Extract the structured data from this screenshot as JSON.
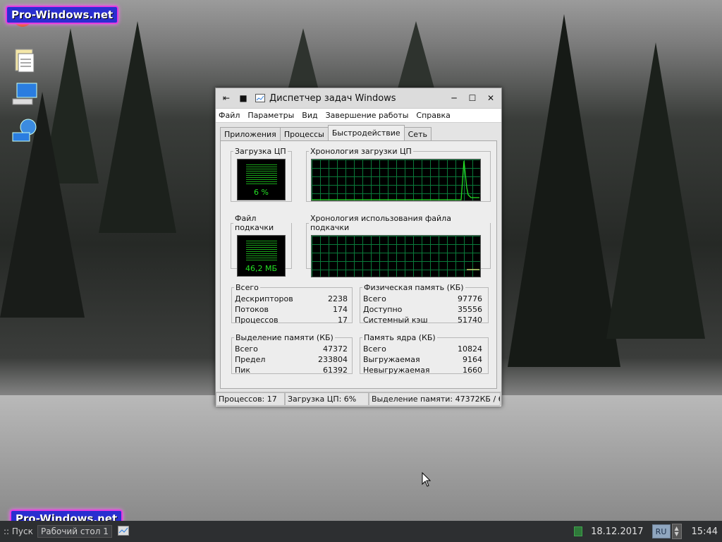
{
  "watermark": "Pro-Windows.net",
  "window": {
    "title": "Диспетчер задач Windows",
    "menu": [
      "Файл",
      "Параметры",
      "Вид",
      "Завершение работы",
      "Справка"
    ],
    "tabs": [
      "Приложения",
      "Процессы",
      "Быстродействие",
      "Сеть"
    ],
    "active_tab": "Быстродействие"
  },
  "cpu": {
    "label": "Загрузка ЦП",
    "value": "6 %",
    "history_label": "Хронология загрузки ЦП"
  },
  "page_file": {
    "label": "Файл подкачки",
    "value": "46,2 МБ",
    "history_label": "Хронология использования файла подкачки"
  },
  "totals": {
    "label": "Всего",
    "rows": [
      {
        "name": "Дескрипторов",
        "value": "2238"
      },
      {
        "name": "Потоков",
        "value": "174"
      },
      {
        "name": "Процессов",
        "value": "17"
      }
    ]
  },
  "physical_memory": {
    "label": "Физическая память (КБ)",
    "rows": [
      {
        "name": "Всего",
        "value": "97776"
      },
      {
        "name": "Доступно",
        "value": "35556"
      },
      {
        "name": "Системный кэш",
        "value": "51740"
      }
    ]
  },
  "commit_charge": {
    "label": "Выделение памяти (КБ)",
    "rows": [
      {
        "name": "Всего",
        "value": "47372"
      },
      {
        "name": "Предел",
        "value": "233804"
      },
      {
        "name": "Пик",
        "value": "61392"
      }
    ]
  },
  "kernel_memory": {
    "label": "Память ядра (КБ)",
    "rows": [
      {
        "name": "Всего",
        "value": "10824"
      },
      {
        "name": "Выгружаемая",
        "value": "9164"
      },
      {
        "name": "Невыгружаемая",
        "value": "1660"
      }
    ]
  },
  "status": {
    "processes": "Процессов: 17",
    "cpu": "Загрузка ЦП: 6%",
    "commit": "Выделение памяти: 47372КБ / 6"
  },
  "taskbar": {
    "start": ":: Пуск",
    "task": "Рабочий стол 1",
    "date": "18.12.2017",
    "lang": "RU",
    "time": "15:44"
  },
  "colors": {
    "graph_line": "#24e024",
    "grid": "#0a7a3a"
  }
}
